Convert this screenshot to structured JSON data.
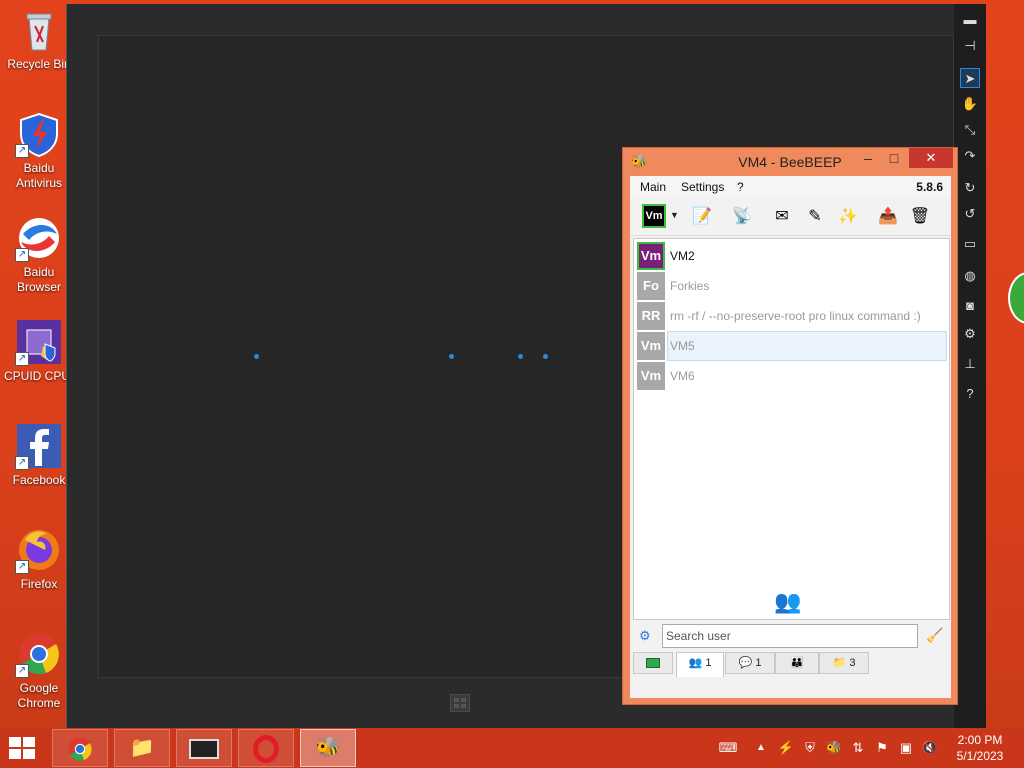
{
  "desktop": {
    "icons": [
      {
        "label": "Recycle Bin",
        "icon": "recycle-bin-icon"
      },
      {
        "label": "Baidu Antivirus",
        "icon": "baidu-antivirus-icon"
      },
      {
        "label": "Baidu Browser",
        "icon": "baidu-browser-icon"
      },
      {
        "label": "CPUID CPU-",
        "icon": "cpuid-icon"
      },
      {
        "label": "Facebook",
        "icon": "facebook-icon"
      },
      {
        "label": "Firefox",
        "icon": "firefox-icon"
      },
      {
        "label": "Google Chrome",
        "icon": "chrome-icon"
      }
    ]
  },
  "vm_viewer": {
    "toolbar_icons": [
      "minimize-icon",
      "pin-icon",
      "pointer-icon",
      "hand-icon",
      "fit-icon",
      "ctrl-alt-del-icon",
      "refresh-icon",
      "reset-icon",
      "monitor-icon",
      "globe-icon",
      "camera-icon",
      "settings-icon",
      "network-icon",
      "help-icon"
    ],
    "help_label": "?"
  },
  "beebeep": {
    "title": "VM4 - BeeBEEP",
    "menu": {
      "main": "Main",
      "settings": "Settings",
      "help": "?"
    },
    "version": "5.8.6",
    "current_user_badge": "Vm",
    "users": [
      {
        "avatar": "Vm",
        "name": "VM2",
        "online": true,
        "selected": false
      },
      {
        "avatar": "Fo",
        "name": "Forkies",
        "online": false,
        "selected": false
      },
      {
        "avatar": "RR",
        "name": "rm -rf / --no-preserve-root pro linux command :)",
        "online": false,
        "selected": false
      },
      {
        "avatar": "Vm",
        "name": "VM5",
        "online": false,
        "selected": true
      },
      {
        "avatar": "Vm",
        "name": "VM6",
        "online": false,
        "selected": false
      }
    ],
    "search": {
      "placeholder": "Search user",
      "value": ""
    },
    "tabs": [
      {
        "icon": "monitor-green-icon",
        "count": ""
      },
      {
        "icon": "users-icon",
        "count": "1"
      },
      {
        "icon": "chat-icon",
        "count": "1"
      },
      {
        "icon": "groups-icon",
        "count": ""
      },
      {
        "icon": "files-icon",
        "count": "3"
      }
    ],
    "colors": {
      "frame": "#f08a5d",
      "online_avatar": "#7a1f7a",
      "offline_avatar": "#a8a8a8",
      "close": "#c7372f"
    }
  },
  "taskbar": {
    "apps": [
      {
        "name": "chrome",
        "icon": "chrome-icon"
      },
      {
        "name": "file-explorer",
        "icon": "folder-icon"
      },
      {
        "name": "vm-viewer",
        "icon": "monitor-icon"
      },
      {
        "name": "opera",
        "icon": "opera-icon"
      },
      {
        "name": "beebeep",
        "icon": "bee-icon"
      }
    ],
    "clock": {
      "time": "2:00 PM",
      "date": "5/1/2023"
    }
  }
}
